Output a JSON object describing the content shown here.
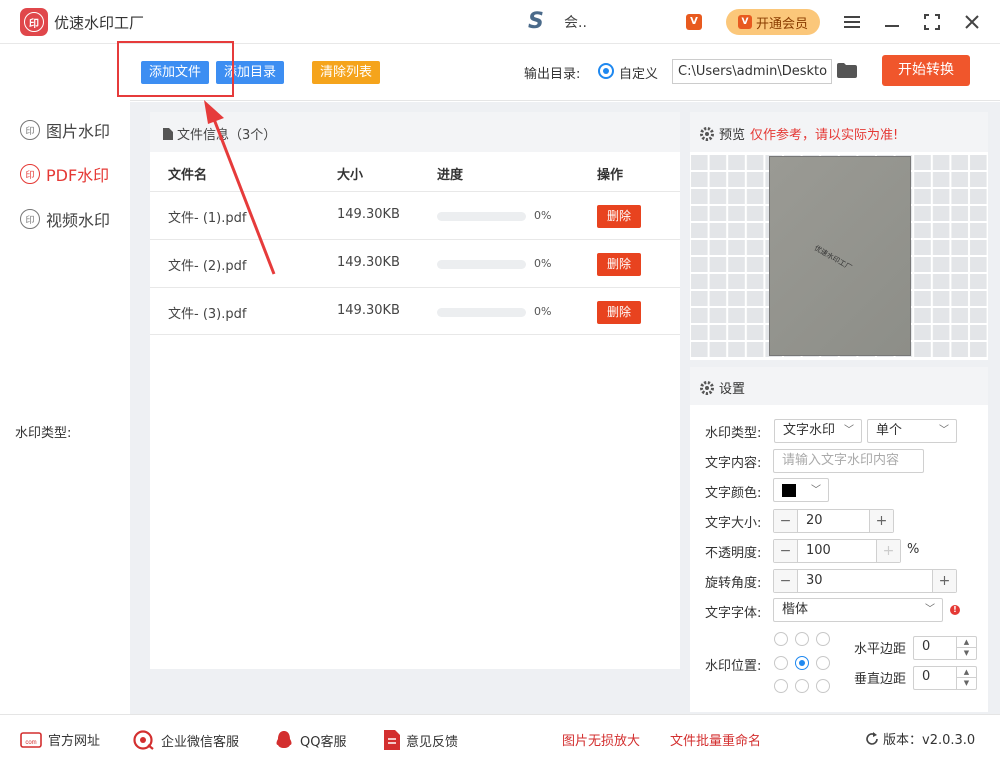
{
  "app": {
    "title": "优速水印工厂",
    "logo_text": "印"
  },
  "user": {
    "name": "会.."
  },
  "titlebar": {
    "vip_label": "开通会员",
    "menu_icon": "menu-icon",
    "minimize_icon": "minimize-icon",
    "maximize_icon": "maximize-icon",
    "close_icon": "close-icon"
  },
  "toolbar": {
    "add_file": "添加文件",
    "add_dir": "添加目录",
    "clear_list": "清除列表",
    "output_label": "输出目录:",
    "custom_label": "自定义",
    "output_path": "C:\\Users\\admin\\Deskto",
    "start_button": "开始转换"
  },
  "sidebar": {
    "items": [
      {
        "label": "图片水印",
        "active": false
      },
      {
        "label": "PDF水印",
        "active": true
      },
      {
        "label": "视频水印",
        "active": false
      }
    ]
  },
  "file_panel": {
    "title": "文件信息（3个）",
    "columns": {
      "name": "文件名",
      "size": "大小",
      "progress": "进度",
      "action": "操作"
    },
    "rows": [
      {
        "name": "文件- (1).pdf",
        "size": "149.30KB",
        "progress": 0,
        "progress_text": "0%",
        "action": "删除"
      },
      {
        "name": "文件- (2).pdf",
        "size": "149.30KB",
        "progress": 0,
        "progress_text": "0%",
        "action": "删除"
      },
      {
        "name": "文件- (3).pdf",
        "size": "149.30KB",
        "progress": 0,
        "progress_text": "0%",
        "action": "删除"
      }
    ]
  },
  "preview": {
    "title": "预览",
    "note": "仅作参考，请以实际为准!",
    "watermark_text": "优速水印工厂"
  },
  "settings": {
    "title": "设置",
    "type_label": "水印类型:",
    "type_value": "文字水印",
    "mode_value": "单个",
    "content_label": "文字内容:",
    "content_placeholder": "请输入文字水印内容",
    "color_label": "文字颜色:",
    "color_value": "#000000",
    "size_label": "文字大小:",
    "size_value": "20",
    "opacity_label": "不透明度:",
    "opacity_value": "100",
    "opacity_unit": "%",
    "rotation_label": "旋转角度:",
    "rotation_value": "30",
    "font_label": "文字字体:",
    "font_value": "楷体",
    "position_label": "水印位置:",
    "selected_position": "center",
    "h_margin_label": "水平边距",
    "h_margin_value": "0",
    "v_margin_label": "垂直边距",
    "v_margin_value": "0"
  },
  "footer": {
    "items": [
      {
        "label": "官方网址",
        "icon": "website-icon"
      },
      {
        "label": "企业微信客服",
        "icon": "wechat-icon"
      },
      {
        "label": "QQ客服",
        "icon": "qq-icon"
      },
      {
        "label": "意见反馈",
        "icon": "feedback-icon"
      }
    ],
    "links": [
      "图片无损放大",
      "文件批量重命名"
    ],
    "version": "版本：v2.0.3.0"
  },
  "colors": {
    "accent_blue": "#3d8ef2",
    "accent_orange": "#f5a41c",
    "danger_red": "#e8431f",
    "start_red": "#f0562c",
    "vip_gold": "#fbc77a"
  }
}
